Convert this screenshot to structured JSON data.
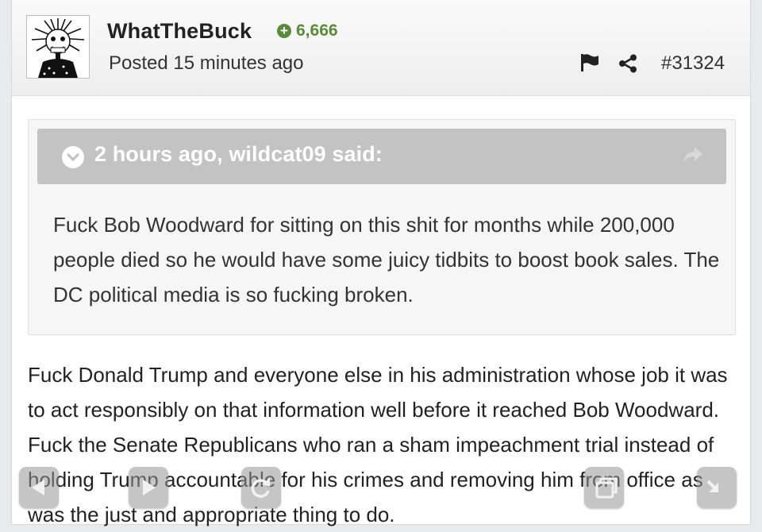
{
  "post": {
    "author": "WhatTheBuck",
    "reputation": "6,666",
    "posted": "Posted 15 minutes ago",
    "post_id": "#31324",
    "icons": {
      "flag": "flag-icon",
      "share": "share-icon",
      "reputation": "plus-circle-icon"
    }
  },
  "quote": {
    "cite": "2 hours ago, wildcat09 said:",
    "text": "Fuck Bob Woodward for sitting on this shit for months while 200,000 people died so he would have some juicy tidbits to boost book sales. The DC political media is so fucking broken.",
    "icons": {
      "toggle": "chevron-down-circle-icon",
      "goto": "share-arrow-icon"
    }
  },
  "body": {
    "text": "Fuck Donald Trump and everyone else in his administration whose job it was to act responsibly on that information well before it reached Bob Woodward. Fuck the Senate Republicans who ran a sham impeachment trial instead of holding Trump accountable for his crimes and removing him from office as was the just and appropriate thing to do."
  },
  "overlay_controls": [
    "back-icon",
    "forward-icon",
    "reload-icon",
    "tabs-icon",
    "exit-fullscreen-icon"
  ]
}
